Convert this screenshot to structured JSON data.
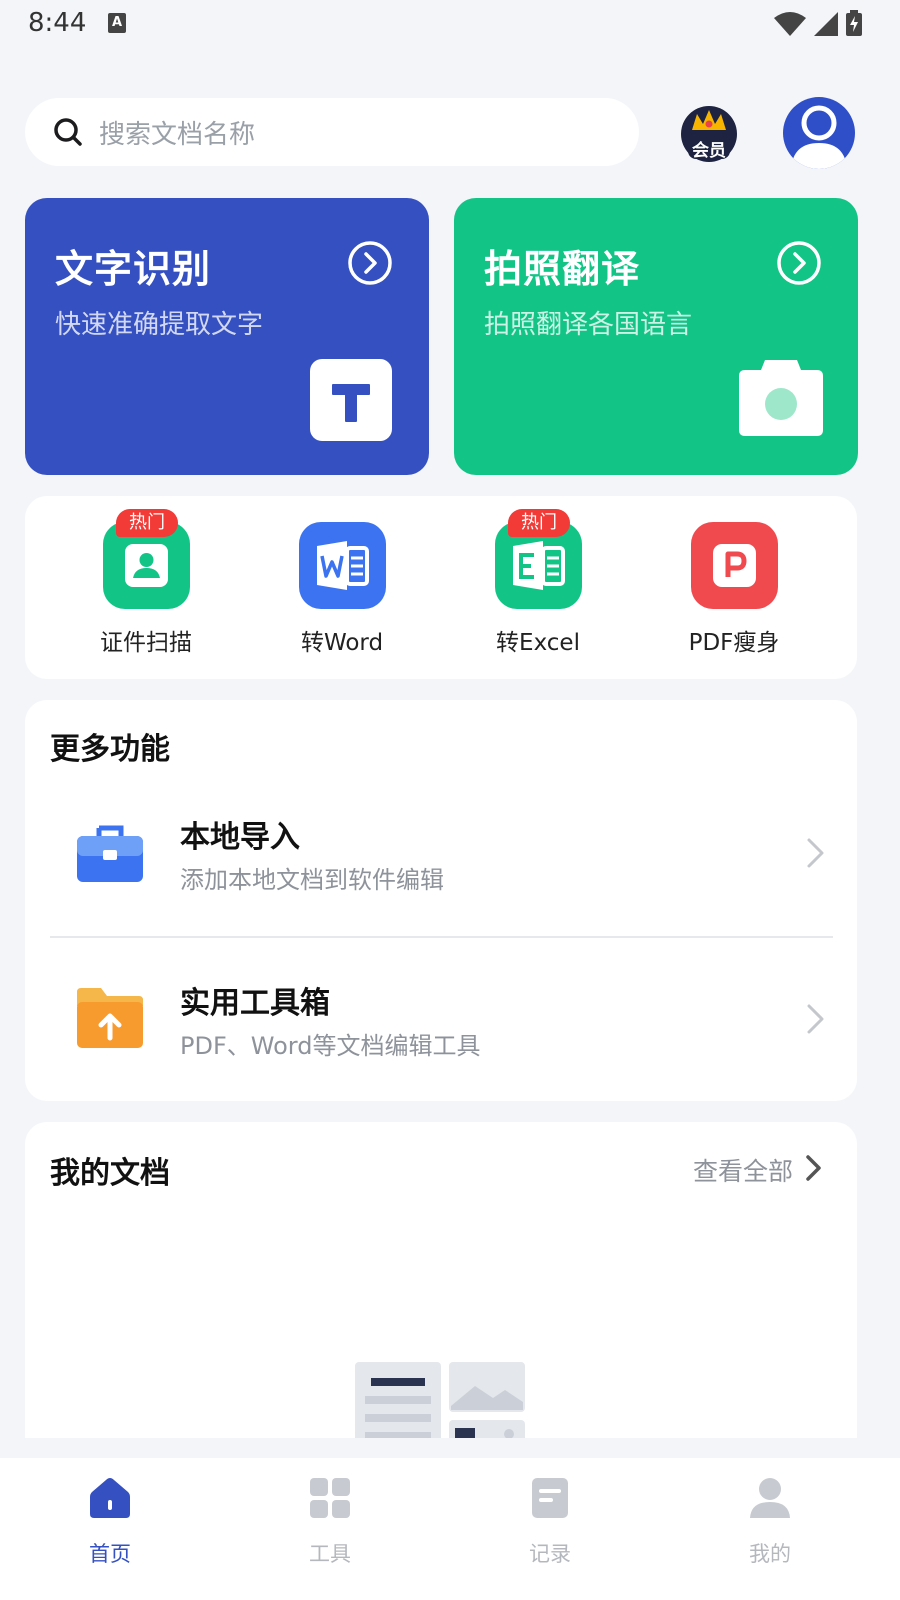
{
  "status_bar": {
    "time": "8:44",
    "notification_glyph": "A"
  },
  "search": {
    "placeholder": "搜索文档名称"
  },
  "header": {
    "vip_label": "会员"
  },
  "feature_cards": {
    "ocr": {
      "title": "文字识别",
      "subtitle": "快速准确提取文字",
      "color": "#3550C1"
    },
    "translate": {
      "title": "拍照翻译",
      "subtitle": "拍照翻译各国语言",
      "color": "#13C487"
    }
  },
  "quick_tools": [
    {
      "label": "证件扫描",
      "badge": "热门",
      "icon": "id-card-icon",
      "color": "#13C487"
    },
    {
      "label": "转Word",
      "badge": "",
      "icon": "word-icon",
      "color": "#3B73F0"
    },
    {
      "label": "转Excel",
      "badge": "热门",
      "icon": "excel-icon",
      "color": "#13C487"
    },
    {
      "label": "PDF瘦身",
      "badge": "",
      "icon": "pdf-icon",
      "color": "#F04A4F"
    }
  ],
  "more_functions": {
    "title": "更多功能",
    "items": [
      {
        "title": "本地导入",
        "subtitle": "添加本地文档到软件编辑",
        "icon": "briefcase-icon"
      },
      {
        "title": "实用工具箱",
        "subtitle": "PDF、Word等文档编辑工具",
        "icon": "folder-upload-icon"
      }
    ]
  },
  "my_docs": {
    "title": "我的文档",
    "view_all": "查看全部"
  },
  "bottom_nav": [
    {
      "label": "首页",
      "icon": "home-icon",
      "active": true
    },
    {
      "label": "工具",
      "icon": "grid-icon",
      "active": false
    },
    {
      "label": "记录",
      "icon": "document-icon",
      "active": false
    },
    {
      "label": "我的",
      "icon": "user-icon",
      "active": false
    }
  ],
  "colors": {
    "primary": "#3550C1",
    "green": "#13C487",
    "hot": "#F23A36",
    "background": "#F3F5F8"
  }
}
